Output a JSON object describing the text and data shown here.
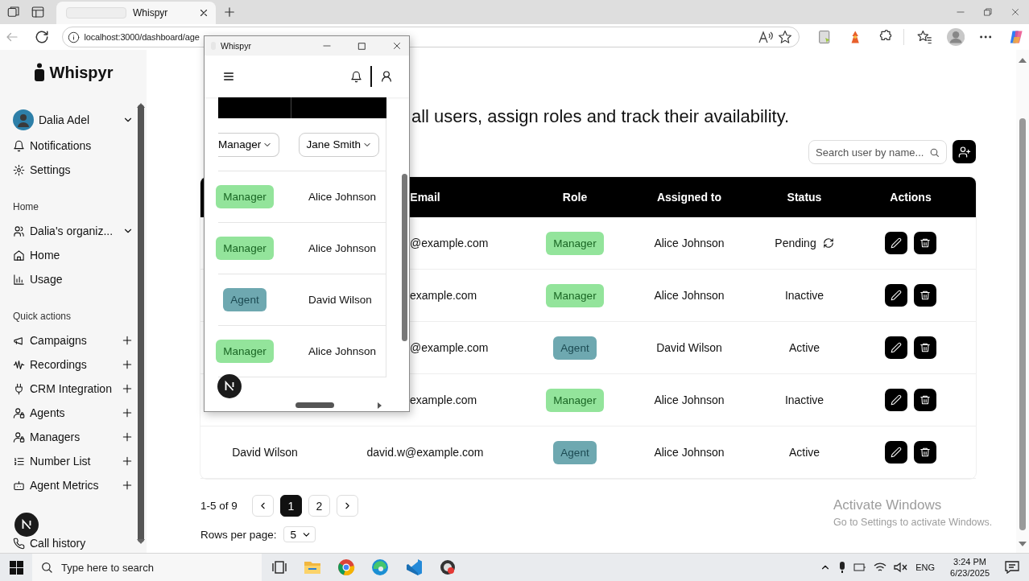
{
  "browser": {
    "tab_title": "Whispyr",
    "url": "localhost:3000/dashboard/age"
  },
  "sidebar": {
    "logo": "Whispyr",
    "user": "Dalia Adel",
    "top_items": [
      {
        "label": "Notifications"
      },
      {
        "label": "Settings"
      }
    ],
    "sections": [
      {
        "title": "Home",
        "items": [
          {
            "label": "Dalia's organiz...",
            "kind": "dropdown"
          },
          {
            "label": "Home",
            "kind": "link"
          },
          {
            "label": "Usage",
            "kind": "link"
          }
        ]
      },
      {
        "title": "Quick actions",
        "items": [
          {
            "label": "Campaigns",
            "kind": "add"
          },
          {
            "label": "Recordings",
            "kind": "add"
          },
          {
            "label": "CRM Integration",
            "kind": "add"
          },
          {
            "label": "Agents",
            "kind": "add"
          },
          {
            "label": "Managers",
            "kind": "add"
          },
          {
            "label": "Number List",
            "kind": "add"
          },
          {
            "label": "Agent Metrics",
            "kind": "add"
          }
        ]
      }
    ],
    "footer_item": {
      "label": "Call history"
    }
  },
  "main": {
    "heading": "all users, assign roles and track their availability.",
    "search_placeholder": "Search user by name...",
    "table": {
      "columns": [
        "Email",
        "Role",
        "Assigned to",
        "Status",
        "Actions"
      ],
      "rows": [
        {
          "email": "@example.com",
          "role": {
            "label": "Manager",
            "kind": "manager"
          },
          "assigned_to": "Alice Johnson",
          "status": "Pending",
          "syncing": true
        },
        {
          "email": "example.com",
          "role": {
            "label": "Manager",
            "kind": "manager"
          },
          "assigned_to": "Alice Johnson",
          "status": "Inactive",
          "syncing": false
        },
        {
          "email": "@example.com",
          "role": {
            "label": "Agent",
            "kind": "agent"
          },
          "assigned_to": "David Wilson",
          "status": "Active",
          "syncing": false
        },
        {
          "email": "example.com",
          "role": {
            "label": "Manager",
            "kind": "manager"
          },
          "assigned_to": "Alice Johnson",
          "status": "Inactive",
          "syncing": false
        },
        {
          "name": "David Wilson",
          "email": "david.w@example.com",
          "role": {
            "label": "Agent",
            "kind": "agent"
          },
          "assigned_to": "Alice Johnson",
          "status": "Active",
          "syncing": false
        }
      ]
    },
    "pagination": {
      "range": "1-5 of 9",
      "pages": [
        {
          "label": "1",
          "selected": true
        },
        {
          "label": "2",
          "selected": false
        }
      ],
      "rows_per_page_label": "Rows per page:",
      "rows_per_page": "5"
    }
  },
  "popup": {
    "title": "Whispyr",
    "filter": {
      "role": "Manager",
      "assigned_to": "Jane Smith"
    },
    "rows": [
      {
        "role": {
          "label": "Manager",
          "kind": "manager"
        },
        "assigned_to": "Alice Johnson"
      },
      {
        "role": {
          "label": "Manager",
          "kind": "manager"
        },
        "assigned_to": "Alice Johnson"
      },
      {
        "role": {
          "label": "Agent",
          "kind": "agent"
        },
        "assigned_to": "David Wilson"
      },
      {
        "role": {
          "label": "Manager",
          "kind": "manager"
        },
        "assigned_to": "Alice Johnson"
      }
    ]
  },
  "activation": {
    "title": "Activate Windows",
    "text": "Go to Settings to activate Windows."
  },
  "taskbar": {
    "search_placeholder": "Type here to search",
    "language": "ENG",
    "time": "3:24 PM",
    "date": "6/23/2025"
  }
}
